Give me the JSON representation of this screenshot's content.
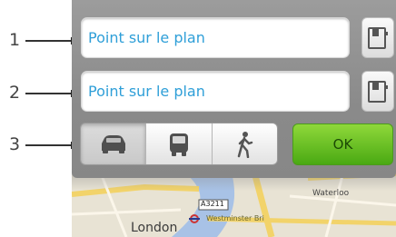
{
  "callouts": [
    "1",
    "2",
    "3"
  ],
  "route": {
    "start": {
      "value": "Point sur le plan"
    },
    "end": {
      "value": "Point sur le plan"
    }
  },
  "transport_modes": [
    {
      "name": "car-icon",
      "selected": true
    },
    {
      "name": "bus-icon",
      "selected": false
    },
    {
      "name": "walk-icon",
      "selected": false
    }
  ],
  "ok_label": "OK",
  "map": {
    "city_label": "London",
    "district_label": "Waterloo",
    "road_shield": "A3211",
    "station_label": "Westminster Bri"
  },
  "colors": {
    "field_text": "#2f9fd8",
    "ok_green": "#5cbc1f"
  }
}
